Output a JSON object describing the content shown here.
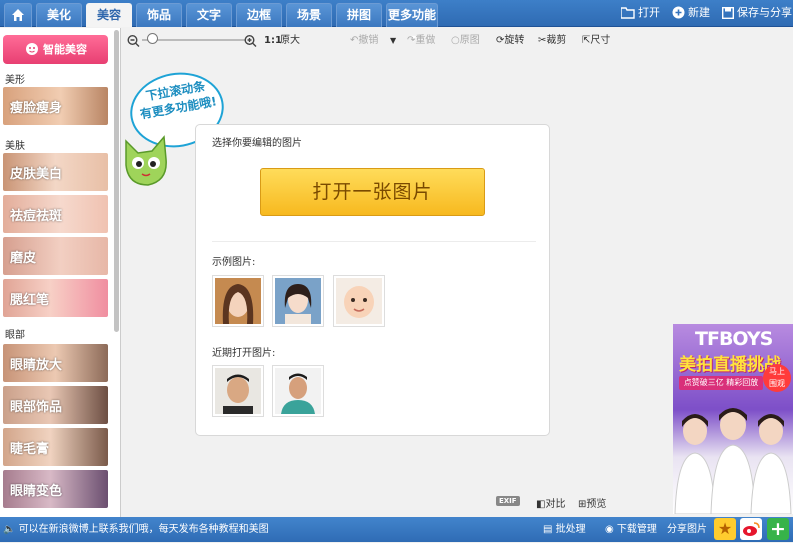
{
  "tabs": [
    {
      "label": "美化"
    },
    {
      "label": "美容"
    },
    {
      "label": "饰品"
    },
    {
      "label": "文字"
    },
    {
      "label": "边框"
    },
    {
      "label": "场景"
    },
    {
      "label": "拼图"
    },
    {
      "label": "更多功能"
    }
  ],
  "top_actions": {
    "open": "打开",
    "new": "新建",
    "save_share": "保存与分享"
  },
  "sidebar": {
    "smart_label": "智能美容",
    "sections": [
      {
        "label": "美形",
        "items": [
          {
            "label": "瘦脸瘦身"
          }
        ]
      },
      {
        "label": "美肤",
        "items": [
          {
            "label": "皮肤美白"
          },
          {
            "label": "祛痘祛斑"
          },
          {
            "label": "磨皮"
          },
          {
            "label": "腮红笔"
          }
        ]
      },
      {
        "label": "眼部",
        "items": [
          {
            "label": "眼睛放大"
          },
          {
            "label": "眼部饰品"
          },
          {
            "label": "睫毛膏"
          },
          {
            "label": "眼睛变色"
          }
        ]
      }
    ]
  },
  "toolbar": {
    "ratio": "1:1",
    "original": "原大",
    "undo": "撤销",
    "redo": "重做",
    "reset": "原图",
    "rotate": "旋转",
    "crop": "裁剪",
    "size": "尺寸",
    "zoom_level": 0.05
  },
  "hint": {
    "line1": "下拉滚动条",
    "line2": "有更多功能哦!"
  },
  "panel": {
    "select_label": "选择你要编辑的图片",
    "open_button": "打开一张图片",
    "example_label": "示例图片:",
    "recent_label": "近期打开图片:"
  },
  "bottom_tools": {
    "exif": "EXIF",
    "compare": "对比",
    "preview": "预览"
  },
  "ad": {
    "brand": "TFBOYS",
    "headline": "美拍直播挑战",
    "sub": "点赞破三亿 精彩回放",
    "badge_line1": "马上",
    "badge_line2": "围观"
  },
  "status": {
    "message": "可以在新浪微博上联系我们哦，每天发布各种教程和美图",
    "batch": "批处理",
    "download": "下载管理",
    "share": "分享图片"
  },
  "colors": {
    "topbar": "#3473bd",
    "accent_pink": "#e83f72",
    "open_button": "#f7b91f",
    "statusbar": "#3978c1"
  }
}
